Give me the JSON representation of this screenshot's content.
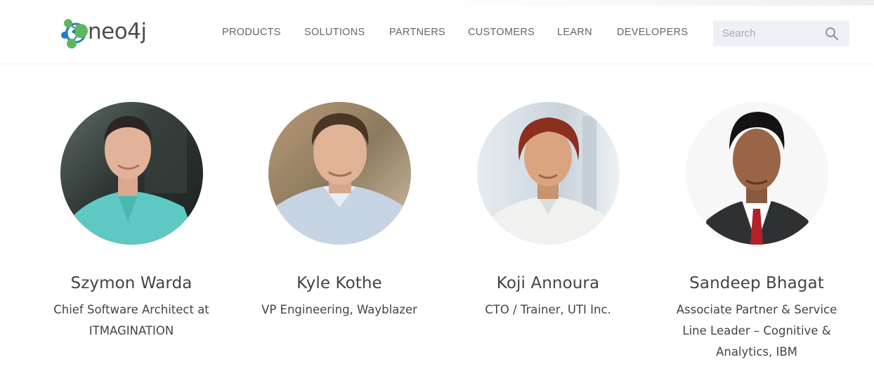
{
  "header": {
    "logo_text": "neo4j",
    "nav": [
      {
        "label": "PRODUCTS"
      },
      {
        "label": "SOLUTIONS"
      },
      {
        "label": "PARTNERS"
      },
      {
        "label": "CUSTOMERS"
      },
      {
        "label": "LEARN"
      },
      {
        "label": "DEVELOPERS"
      }
    ],
    "search": {
      "placeholder": "Search",
      "value": ""
    }
  },
  "speakers": [
    {
      "name": "Szymon Warda",
      "title": "Chief Software Architect at ITMAGINATION"
    },
    {
      "name": "Kyle Kothe",
      "title": "VP Engineering, Wayblazer"
    },
    {
      "name": "Koji Annoura",
      "title": "CTO / Trainer, UTI Inc."
    },
    {
      "name": "Sandeep Bhagat",
      "title": "Associate Partner & Service Line Leader – Cognitive & Analytics, IBM"
    }
  ],
  "colors": {
    "brand_blue": "#1a80c4",
    "brand_green": "#5cb85c",
    "nav_text": "#666666",
    "search_bg": "#edf1f5"
  }
}
